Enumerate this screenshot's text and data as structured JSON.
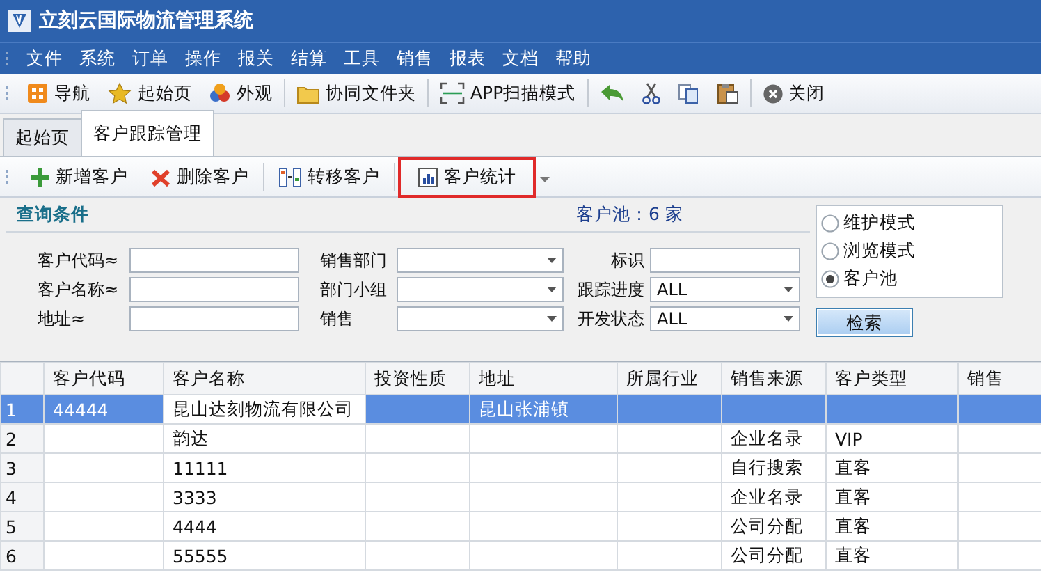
{
  "window": {
    "title": "立刻云国际物流管理系统"
  },
  "menu": [
    "文件",
    "系统",
    "订单",
    "操作",
    "报关",
    "结算",
    "工具",
    "销售",
    "报表",
    "文档",
    "帮助"
  ],
  "toolbar": [
    {
      "kind": "button",
      "label": "导航"
    },
    {
      "kind": "button",
      "label": "起始页"
    },
    {
      "kind": "button",
      "label": "外观"
    },
    {
      "kind": "separator"
    },
    {
      "kind": "button",
      "label": "协同文件夹"
    },
    {
      "kind": "separator"
    },
    {
      "kind": "button",
      "label": "APP扫描模式"
    },
    {
      "kind": "separator"
    },
    {
      "kind": "button"
    },
    {
      "kind": "button"
    },
    {
      "kind": "button"
    },
    {
      "kind": "button"
    },
    {
      "kind": "separator"
    },
    {
      "kind": "button",
      "label": "关闭"
    }
  ],
  "tabs": [
    {
      "label": "起始页",
      "selected": false
    },
    {
      "label": "客户跟踪管理",
      "selected": true
    }
  ],
  "actions": [
    {
      "kind": "button",
      "label": "新增客户",
      "highlighted": false
    },
    {
      "kind": "button",
      "label": "删除客户",
      "highlighted": false
    },
    {
      "kind": "separator"
    },
    {
      "kind": "button",
      "label": "转移客户",
      "highlighted": false
    },
    {
      "kind": "separator"
    },
    {
      "kind": "button",
      "label": "客户统计",
      "highlighted": true
    }
  ],
  "query": {
    "title": "查询条件",
    "pool_count": "客户池：6 家",
    "fields": [
      {
        "label": "客户代码≈",
        "kind": "text"
      },
      {
        "label": "销售部门",
        "kind": "combo"
      },
      {
        "label": "标识",
        "kind": "text"
      },
      {
        "label": "客户名称≈",
        "kind": "text"
      },
      {
        "label": "部门小组",
        "kind": "combo"
      },
      {
        "label": "跟踪进度",
        "kind": "combo",
        "value": "ALL"
      },
      {
        "label": "地址≈",
        "kind": "text"
      },
      {
        "label": "销售",
        "kind": "combo"
      },
      {
        "label": "开发状态",
        "kind": "combo",
        "value": "ALL"
      }
    ],
    "modes": [
      {
        "label": "维护模式",
        "selected": false
      },
      {
        "label": "浏览模式",
        "selected": false
      },
      {
        "label": "客户池",
        "selected": true
      }
    ],
    "search_button": "检索"
  },
  "grid": {
    "columns": [
      "客户代码",
      "客户名称",
      "投资性质",
      "地址",
      "所属行业",
      "销售来源",
      "客户类型",
      "销售"
    ],
    "rows": [
      {
        "number": "1",
        "selected": true,
        "focused": [
          false,
          true,
          false,
          false,
          false,
          false,
          false,
          false
        ],
        "cells": [
          "44444",
          "昆山达刻物流有限公司",
          null,
          "昆山张浦镇",
          null,
          null,
          null,
          null
        ]
      },
      {
        "number": "2",
        "selected": false,
        "cells": [
          null,
          "韵达",
          null,
          null,
          null,
          "企业名录",
          "VIP",
          null
        ]
      },
      {
        "number": "3",
        "selected": false,
        "cells": [
          null,
          "11111",
          null,
          null,
          null,
          "自行搜索",
          "直客",
          null
        ]
      },
      {
        "number": "4",
        "selected": false,
        "cells": [
          null,
          "3333",
          null,
          null,
          null,
          "企业名录",
          "直客",
          null
        ]
      },
      {
        "number": "5",
        "selected": false,
        "cells": [
          null,
          "4444",
          null,
          null,
          null,
          "公司分配",
          "直客",
          null
        ]
      },
      {
        "number": "6",
        "selected": false,
        "cells": [
          null,
          "55555",
          null,
          null,
          null,
          "公司分配",
          "直客",
          null
        ]
      }
    ]
  }
}
